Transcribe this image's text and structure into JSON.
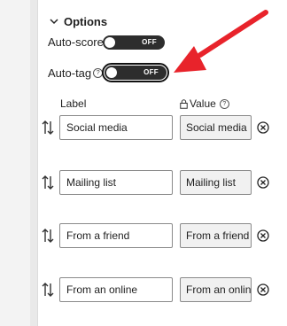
{
  "options": {
    "title": "Options",
    "auto_score_label": "Auto-score",
    "auto_score_state": "OFF",
    "auto_tag_label": "Auto-tag",
    "auto_tag_help": "?",
    "auto_tag_state": "OFF"
  },
  "columns": {
    "label": "Label",
    "value": "Value",
    "value_help": "?"
  },
  "rows": [
    {
      "label": "Social media",
      "value": "Social media"
    },
    {
      "label": "Mailing list",
      "value": "Mailing list"
    },
    {
      "label": "From a friend",
      "value": "From a friend"
    },
    {
      "label": "From an online",
      "value": "From an online"
    }
  ],
  "colors": {
    "accent_arrow": "#e8232b",
    "toggle_bg": "#2d2d2d",
    "panel_bg": "#ffffff"
  },
  "icons": [
    "chevron-down-icon",
    "help-icon",
    "lock-icon",
    "reorder-icon",
    "remove-circle-icon",
    "annotation-arrow-icon"
  ]
}
